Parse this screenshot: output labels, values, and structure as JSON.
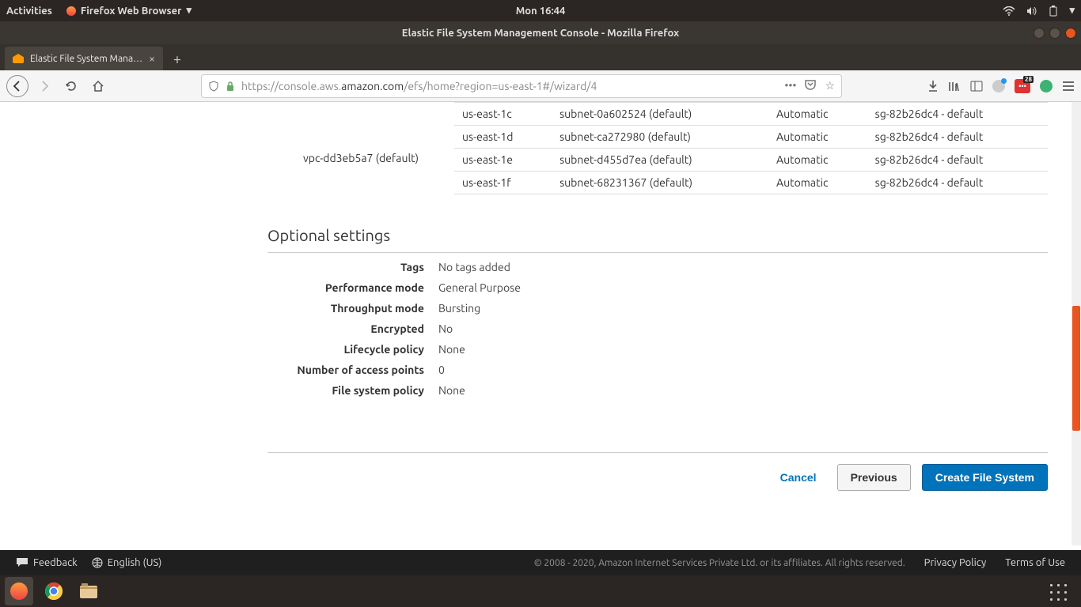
{
  "ubuntu": {
    "activities": "Activities",
    "app_menu": "Firefox Web Browser",
    "clock": "Mon 16:44"
  },
  "window": {
    "title": "Elastic File System Management Console - Mozilla Firefox"
  },
  "tab": {
    "title": "Elastic File System Mana…"
  },
  "url": {
    "prefix": "https://console.aws.",
    "host": "amazon.com",
    "path": "/efs/home?region=us-east-1#/wizard/4"
  },
  "mount": {
    "vpc": "vpc-dd3eb5a7 (default)",
    "rows": [
      {
        "az": "us-east-1c",
        "subnet": "subnet-0a602524 (default)",
        "ip": "Automatic",
        "sg": "sg-82b26dc4 - default"
      },
      {
        "az": "us-east-1d",
        "subnet": "subnet-ca272980 (default)",
        "ip": "Automatic",
        "sg": "sg-82b26dc4 - default"
      },
      {
        "az": "us-east-1e",
        "subnet": "subnet-d455d7ea (default)",
        "ip": "Automatic",
        "sg": "sg-82b26dc4 - default"
      },
      {
        "az": "us-east-1f",
        "subnet": "subnet-68231367 (default)",
        "ip": "Automatic",
        "sg": "sg-82b26dc4 - default"
      }
    ]
  },
  "optional": {
    "heading": "Optional settings",
    "tags_k": "Tags",
    "tags_v": "No tags added",
    "perf_k": "Performance mode",
    "perf_v": "General Purpose",
    "thr_k": "Throughput mode",
    "thr_v": "Bursting",
    "enc_k": "Encrypted",
    "enc_v": "No",
    "life_k": "Lifecycle policy",
    "life_v": "None",
    "ap_k": "Number of access points",
    "ap_v": "0",
    "fsp_k": "File system policy",
    "fsp_v": "None"
  },
  "wizard": {
    "cancel": "Cancel",
    "previous": "Previous",
    "create": "Create File System"
  },
  "footer": {
    "feedback": "Feedback",
    "lang": "English (US)",
    "copyright": "© 2008 - 2020, Amazon Internet Services Private Ltd. or its affiliates. All rights reserved.",
    "privacy": "Privacy Policy",
    "terms": "Terms of Use"
  }
}
